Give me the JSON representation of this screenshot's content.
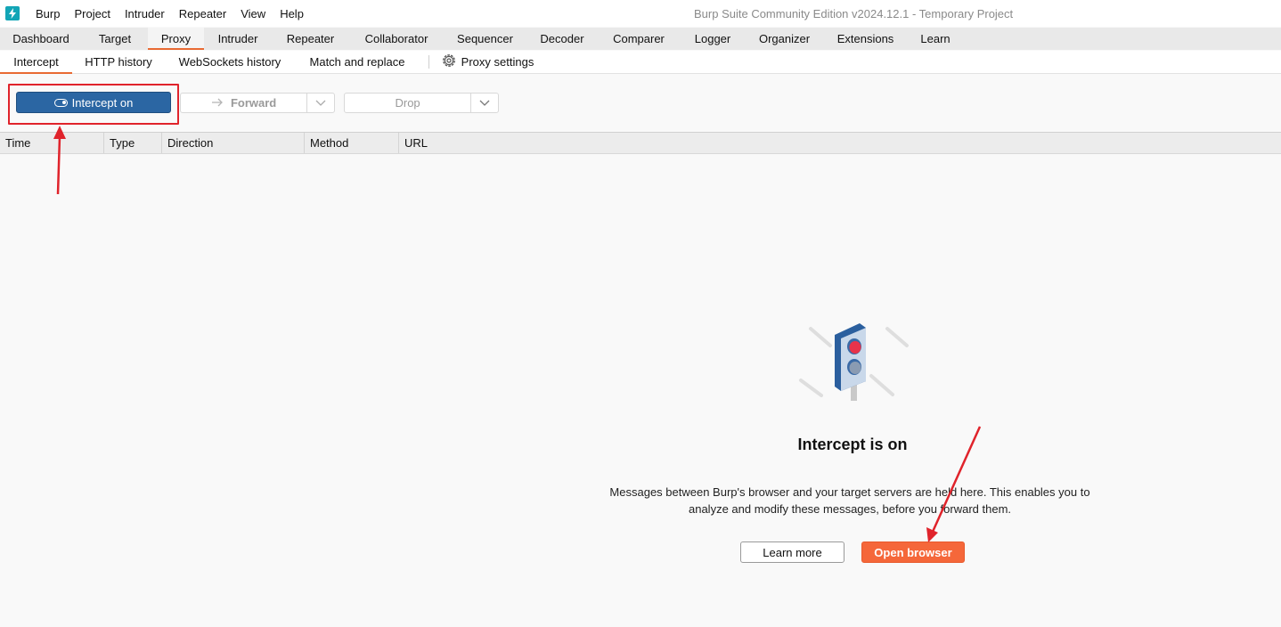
{
  "menu": {
    "items": [
      "Burp",
      "Project",
      "Intruder",
      "Repeater",
      "View",
      "Help"
    ],
    "window_title": "Burp Suite Community Edition v2024.12.1 - Temporary Project"
  },
  "main_tabs": [
    "Dashboard",
    "Target",
    "Proxy",
    "Intruder",
    "Repeater",
    "Collaborator",
    "Sequencer",
    "Decoder",
    "Comparer",
    "Logger",
    "Organizer",
    "Extensions",
    "Learn"
  ],
  "main_tabs_active": "Proxy",
  "sub_tabs": [
    "Intercept",
    "HTTP history",
    "WebSockets history",
    "Match and replace"
  ],
  "sub_tabs_active": "Intercept",
  "proxy_settings_label": "Proxy settings",
  "toolbar": {
    "intercept_label": "Intercept on",
    "forward_label": "Forward",
    "drop_label": "Drop"
  },
  "table": {
    "columns": [
      "Time",
      "Type",
      "Direction",
      "Method",
      "URL"
    ]
  },
  "empty_state": {
    "title": "Intercept is on",
    "description": "Messages between Burp's browser and your target servers are held here. This enables you to analyze and modify these messages, before you forward them.",
    "learn_more_label": "Learn more",
    "open_browser_label": "Open browser"
  },
  "colors": {
    "accent": "#e86a33",
    "intercept_button": "#2b66a3",
    "open_browser_button": "#f5673a",
    "annotation_red": "#e0232b"
  }
}
